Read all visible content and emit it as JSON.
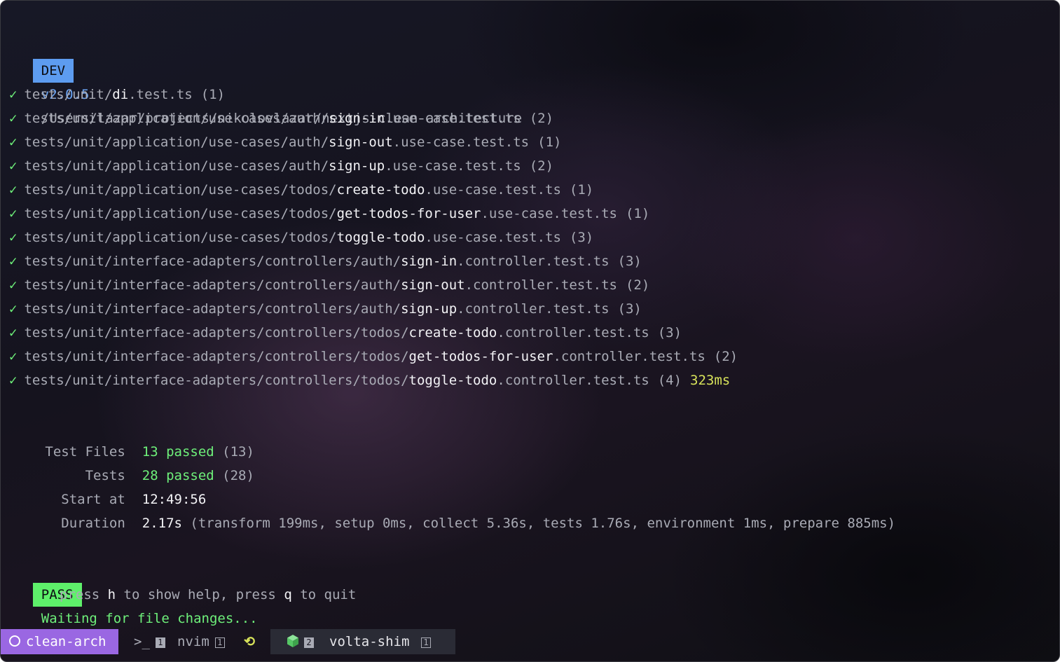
{
  "header": {
    "badge": "DEV",
    "version": "v2.0.5",
    "path": "/Users/lazar/projects/nikolovlazar/nextjs-clean-architecture"
  },
  "check_glyph": "✓",
  "tests": [
    {
      "prefix": "tests/unit/",
      "name": "di",
      "suffix": ".test.ts",
      "count": "(1)",
      "time": ""
    },
    {
      "prefix": "tests/unit/application/use-cases/auth/",
      "name": "sign-in",
      "suffix": ".use-case.test.ts",
      "count": "(2)",
      "time": ""
    },
    {
      "prefix": "tests/unit/application/use-cases/auth/",
      "name": "sign-out",
      "suffix": ".use-case.test.ts",
      "count": "(1)",
      "time": ""
    },
    {
      "prefix": "tests/unit/application/use-cases/auth/",
      "name": "sign-up",
      "suffix": ".use-case.test.ts",
      "count": "(2)",
      "time": ""
    },
    {
      "prefix": "tests/unit/application/use-cases/todos/",
      "name": "create-todo",
      "suffix": ".use-case.test.ts",
      "count": "(1)",
      "time": ""
    },
    {
      "prefix": "tests/unit/application/use-cases/todos/",
      "name": "get-todos-for-user",
      "suffix": ".use-case.test.ts",
      "count": "(1)",
      "time": ""
    },
    {
      "prefix": "tests/unit/application/use-cases/todos/",
      "name": "toggle-todo",
      "suffix": ".use-case.test.ts",
      "count": "(3)",
      "time": ""
    },
    {
      "prefix": "tests/unit/interface-adapters/controllers/auth/",
      "name": "sign-in",
      "suffix": ".controller.test.ts",
      "count": "(3)",
      "time": ""
    },
    {
      "prefix": "tests/unit/interface-adapters/controllers/auth/",
      "name": "sign-out",
      "suffix": ".controller.test.ts",
      "count": "(2)",
      "time": ""
    },
    {
      "prefix": "tests/unit/interface-adapters/controllers/auth/",
      "name": "sign-up",
      "suffix": ".controller.test.ts",
      "count": "(3)",
      "time": ""
    },
    {
      "prefix": "tests/unit/interface-adapters/controllers/todos/",
      "name": "create-todo",
      "suffix": ".controller.test.ts",
      "count": "(3)",
      "time": ""
    },
    {
      "prefix": "tests/unit/interface-adapters/controllers/todos/",
      "name": "get-todos-for-user",
      "suffix": ".controller.test.ts",
      "count": "(2)",
      "time": ""
    },
    {
      "prefix": "tests/unit/interface-adapters/controllers/todos/",
      "name": "toggle-todo",
      "suffix": ".controller.test.ts",
      "count": "(4)",
      "time": "323ms"
    }
  ],
  "summary": {
    "files_label": "Test Files",
    "files_passed": "13 passed",
    "files_total": "(13)",
    "tests_label": "Tests",
    "tests_passed": "28 passed",
    "tests_total": "(28)",
    "start_label": "Start at",
    "start_value": "12:49:56",
    "duration_label": "Duration",
    "duration_value": "2.17s",
    "duration_detail": "(transform 199ms, setup 0ms, collect 5.36s, tests 1.76s, environment 1ms, prepare 885ms)"
  },
  "footer": {
    "badge": "PASS",
    "message": "Waiting for file changes...",
    "help_press1": "press ",
    "help_key1": "h",
    "help_mid": " to show help, press ",
    "help_key2": "q",
    "help_end": " to quit"
  },
  "statusbar": {
    "session_name": "clean-arch",
    "prompt_glyph": ">_",
    "window1_index": "1",
    "window2_label": "nvim",
    "window2_index": "1",
    "active_index": "2",
    "active_label": "volta-shim",
    "active_pane_index": "1"
  },
  "colors": {
    "accent_green": "#6ef07a",
    "accent_blue": "#5d9cf0",
    "accent_purple": "#9a67e2",
    "accent_yellow": "#d7e25a"
  },
  "icons": {
    "session": "circle-icon",
    "prompt": "terminal-prompt-icon",
    "refresh": "refresh-icon",
    "node": "node-cube-icon"
  }
}
